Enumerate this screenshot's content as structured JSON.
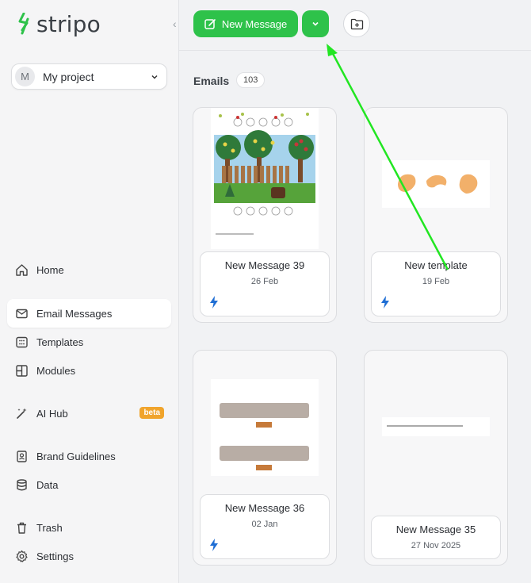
{
  "brand": {
    "name": "stripo",
    "green": "#2ec24a"
  },
  "sidebar": {
    "collapse_icon": "chevron-left-icon",
    "project": {
      "avatar": "M",
      "name": "My project"
    },
    "items": [
      {
        "label": "Home",
        "icon": "home-icon"
      },
      {
        "label": "Email Messages",
        "icon": "mail-icon",
        "active": true
      },
      {
        "label": "Templates",
        "icon": "templates-icon"
      },
      {
        "label": "Modules",
        "icon": "modules-icon"
      },
      {
        "label": "AI Hub",
        "icon": "magic-wand-icon",
        "badge": "beta"
      },
      {
        "label": "Brand Guidelines",
        "icon": "book-icon"
      },
      {
        "label": "Data",
        "icon": "database-icon"
      },
      {
        "label": "Trash",
        "icon": "trash-icon"
      },
      {
        "label": "Settings",
        "icon": "gear-icon"
      }
    ]
  },
  "toolbar": {
    "new_message_label": "New Message"
  },
  "emails": {
    "title": "Emails",
    "count": "103",
    "cards": [
      {
        "name": "New Message 39",
        "date": "26 Feb"
      },
      {
        "name": "New template",
        "date": "19 Feb"
      },
      {
        "name": "New Message 36",
        "date": "02 Jan"
      },
      {
        "name": "New Message 35",
        "date": "27 Nov 2025"
      }
    ]
  }
}
